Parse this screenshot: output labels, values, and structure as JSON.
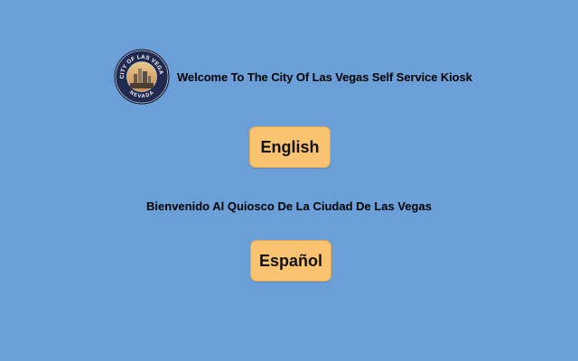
{
  "kiosk": {
    "welcome_en": "Welcome To The City Of Las Vegas Self Service Kiosk",
    "welcome_es": "Bienvenido Al Quiosco De La Ciudad De Las Vegas",
    "english_label": "English",
    "spanish_label": "Español"
  },
  "seal": {
    "top_text": "CITY OF LAS VEGAS",
    "bottom_text": "NEVADA"
  },
  "colors": {
    "background": "#6a9fd8",
    "button": "#f9c36f",
    "seal_ring": "#1f2a4e"
  }
}
